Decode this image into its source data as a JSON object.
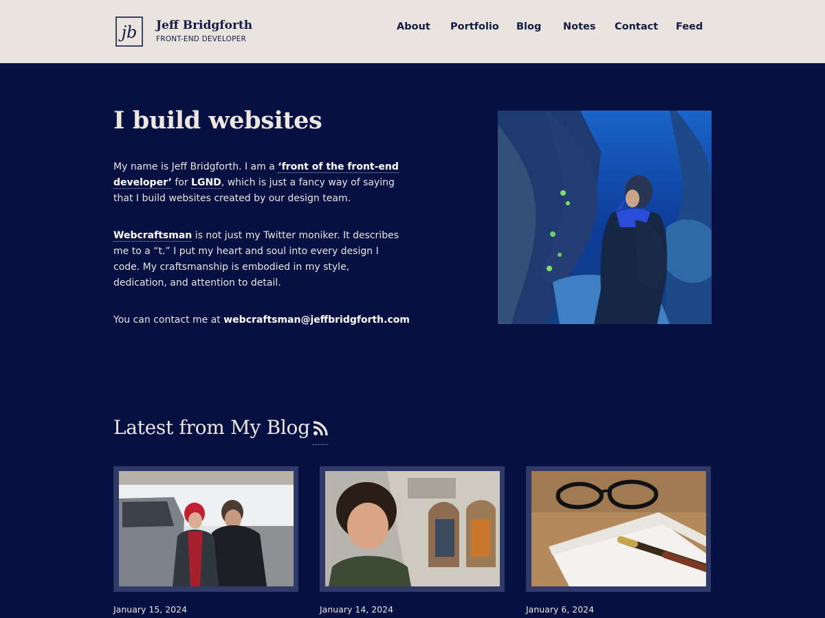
{
  "header": {
    "logo_text": "jb",
    "name": "Jeff Bridgforth",
    "tagline": "FRONT-END DEVELOPER",
    "nav": [
      {
        "label": "About"
      },
      {
        "label": "Portfolio"
      },
      {
        "label": "Blog"
      },
      {
        "label": "Notes"
      },
      {
        "label": "Contact"
      },
      {
        "label": "Feed"
      }
    ]
  },
  "hero": {
    "title": "I build websites",
    "p1": {
      "t1": "My name is Jeff Bridgforth. I am a ",
      "link1": "‘front of the front-end developer’",
      "t2": " for ",
      "link2": "LGND",
      "t3": ", which is just a fancy way of saying that I build websites created by our design team."
    },
    "p2": {
      "link": "Webcraftsman",
      "text": " is not just my Twitter moniker. It describes me to a “t.” I put my heart and soul into every design I code. My craftsmanship is embodied in my style, dedication, and attention to detail."
    },
    "p3": {
      "text": "You can contact me at ",
      "email": "webcraftsman@jeffbridgforth.com"
    },
    "photo_icon": "aquarium-photo"
  },
  "blog": {
    "heading": "Latest from My Blog",
    "feed_icon": "rss-icon",
    "posts": [
      {
        "date": "January 15, 2024",
        "image": "snow-selfie-photo"
      },
      {
        "date": "January 14, 2024",
        "image": "barcelona-selfie-photo"
      },
      {
        "date": "January 6, 2024",
        "image": "notebook-pen-glasses-photo"
      }
    ]
  },
  "colors": {
    "header_bg": "#e9e5de",
    "page_bg": "#061042",
    "text_dark": "#131a45",
    "text_light": "#e9e6df",
    "card_frame": "#2f3a69"
  }
}
